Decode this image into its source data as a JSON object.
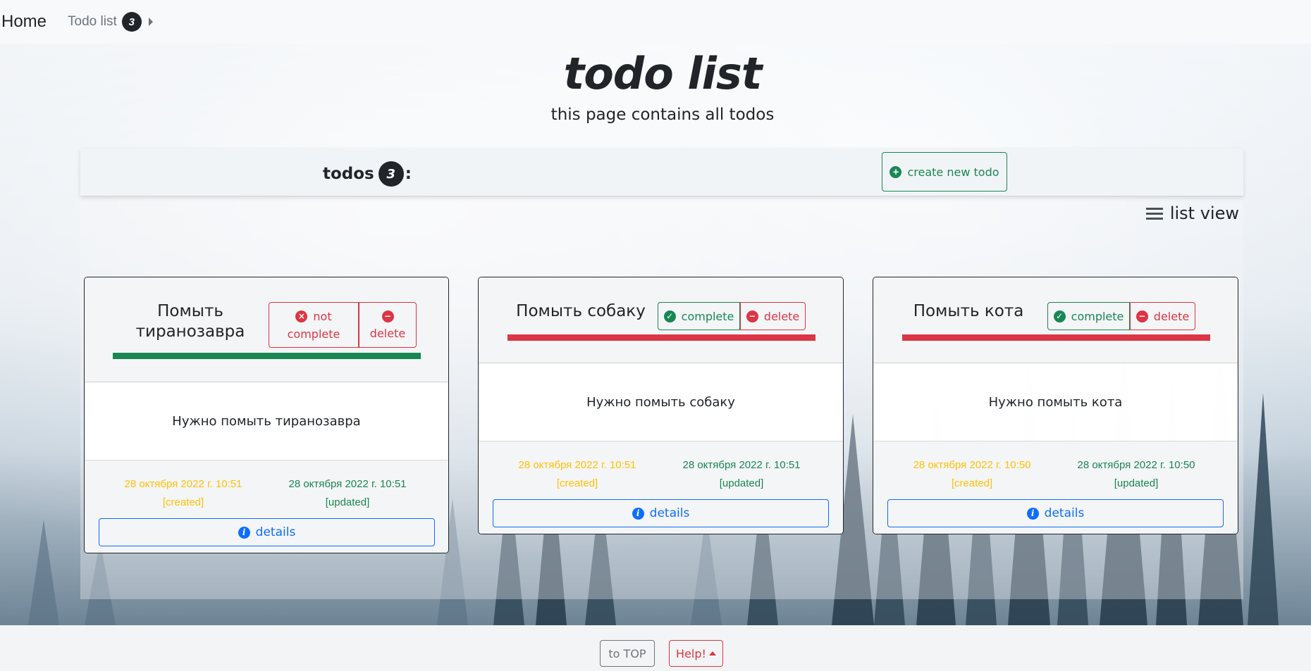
{
  "nav": {
    "brand": "Home",
    "todo_link": "Todo list",
    "todo_count": "3"
  },
  "header": {
    "title": "todo list",
    "subtitle": "this page contains all todos"
  },
  "panel": {
    "todos_label": "todos",
    "todos_count": "3",
    "todos_suffix": ":",
    "create_button": "create new todo",
    "view_toggle": "list view"
  },
  "cards": [
    {
      "title": "Помыть тиранозавра",
      "status_button_line1": "not",
      "status_button_line2": "complete",
      "delete_button": "delete",
      "status_bar_color": "#198754",
      "description": "Нужно помыть тиранозавра",
      "created_date": "28 октября 2022 г. 10:51",
      "created_label": "[created]",
      "updated_date": "28 октября 2022 г. 10:51",
      "updated_label": "[updated]",
      "details_button": "details"
    },
    {
      "title": "Помыть собаку",
      "status_button": "complete",
      "delete_button": "delete",
      "status_bar_color": "#dc3545",
      "description": "Нужно помыть собаку",
      "created_date": "28 октября 2022 г. 10:51",
      "created_label": "[created]",
      "updated_date": "28 октября 2022 г. 10:51",
      "updated_label": "[updated]",
      "details_button": "details"
    },
    {
      "title": "Помыть кота",
      "status_button": "complete",
      "delete_button": "delete",
      "status_bar_color": "#dc3545",
      "description": "Нужно помыть кота",
      "created_date": "28 октября 2022 г. 10:50",
      "created_label": "[created]",
      "updated_date": "28 октября 2022 г. 10:50",
      "updated_label": "[updated]",
      "details_button": "details"
    }
  ],
  "footer": {
    "to_top": "to TOP",
    "help": "Help!"
  },
  "icons": {
    "add": "plus-circle-icon",
    "check": "check-circle-icon",
    "cross": "x-circle-icon",
    "minus": "dash-circle-icon",
    "info": "info-circle-icon",
    "list": "list-check-icon"
  },
  "colors": {
    "success": "#198754",
    "danger": "#dc3545",
    "primary": "#0d6efd",
    "warning": "#ffc107",
    "dark": "#212529"
  }
}
